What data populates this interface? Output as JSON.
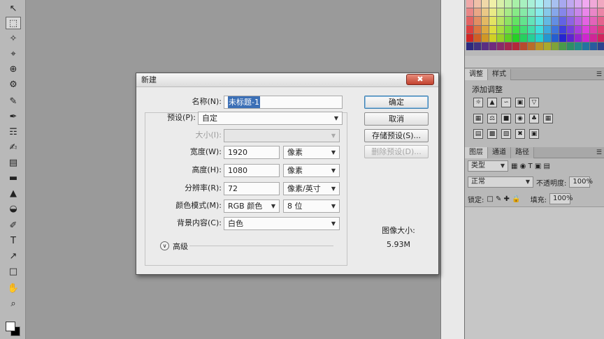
{
  "toolbar": {
    "icons": [
      "↖",
      "⬚",
      "✧",
      "⌖",
      "⊕",
      "⚙",
      "✎",
      "✒",
      "☶",
      "✍",
      "▤",
      "▬",
      "▲",
      "◒",
      "✐",
      "T",
      "↗",
      "□",
      "✋",
      "⌕"
    ]
  },
  "colors": {
    "spectrum_bottom": [
      "#2d2a7f",
      "#41327f",
      "#5a2f83",
      "#6f2b7e",
      "#892a6a",
      "#a4264e",
      "#b3293a",
      "#b84a2e",
      "#b86d2a",
      "#b89428",
      "#aaa92c",
      "#7fa33a",
      "#4a9a4b",
      "#2e8f66",
      "#248a8a",
      "#2274a0",
      "#2a5b9e",
      "#2e438f"
    ]
  },
  "right_panel": {
    "adjust_tabs": [
      "调整",
      "样式"
    ],
    "adjust_title": "添加调整",
    "layer_tabs": [
      "图层",
      "通道",
      "路径"
    ],
    "kind_filter": "类型",
    "blend_mode": "正常",
    "opacity_label": "不透明度:",
    "opacity_value": "100%",
    "lock_label": "锁定:",
    "fill_label": "填充:",
    "fill_value": "100%"
  },
  "dialog": {
    "title": "新建",
    "close_glyph": "✖",
    "name_label": "名称(N):",
    "name_value": "未标题-1",
    "preset_label": "预设(P):",
    "preset_value": "自定",
    "size_label": "大小(I):",
    "width_label": "宽度(W):",
    "width_value": "1920",
    "width_unit": "像素",
    "height_label": "高度(H):",
    "height_value": "1080",
    "height_unit": "像素",
    "resolution_label": "分辨率(R):",
    "resolution_value": "72",
    "resolution_unit": "像素/英寸",
    "color_mode_label": "颜色模式(M):",
    "color_mode_value": "RGB 颜色",
    "bit_depth_value": "8 位",
    "background_label": "背景内容(C):",
    "background_value": "白色",
    "advanced_label": "高级",
    "ok_button": "确定",
    "cancel_button": "取消",
    "save_preset_button": "存储预设(S)...",
    "delete_preset_button": "删除预设(D)...",
    "image_size_label": "图像大小:",
    "image_size_value": "5.93M"
  }
}
